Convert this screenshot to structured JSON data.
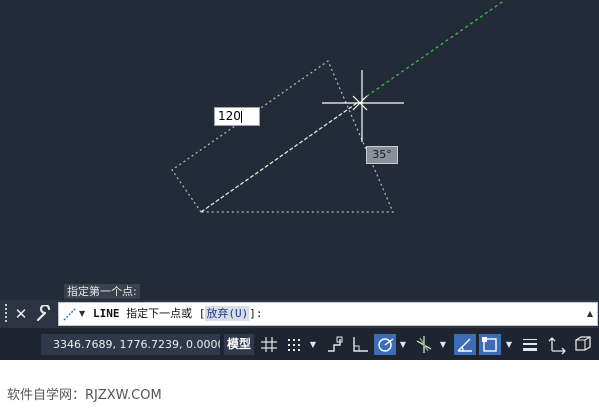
{
  "canvas": {
    "dynamic_input_value": "120",
    "angle_tooltip": "35°",
    "colors": {
      "background": "#222b37",
      "rubber_band": "#44c04a",
      "polar_arc": "#b8bcc2",
      "crosshair": "#ffffff"
    }
  },
  "command_history": "指定第一个点:",
  "command_line": {
    "command": "LINE",
    "prompt": "指定下一点或 [",
    "option": "放弃(U)",
    "suffix": "]:"
  },
  "statusbar": {
    "coordinates": "3346.7689, 1776.7239, 0.0000",
    "model_label": "模型",
    "buttons": [
      {
        "icon": "grid-icon",
        "active": false
      },
      {
        "icon": "snap-icon",
        "active": false
      },
      {
        "icon": "infer-constraints-icon",
        "active": false
      },
      {
        "icon": "ortho-icon",
        "active": false
      },
      {
        "icon": "polar-tracking-icon",
        "active": true
      },
      {
        "icon": "isodraft-icon",
        "active": false
      },
      {
        "icon": "object-snap-tracking-icon",
        "active": true
      },
      {
        "icon": "object-snap-icon",
        "active": true
      },
      {
        "icon": "lineweight-icon",
        "active": false
      },
      {
        "icon": "annotation-scale-icon",
        "active": false
      },
      {
        "icon": "workspace-icon",
        "active": false
      }
    ]
  },
  "watermark": "软件自学网：RJZXW.COM"
}
